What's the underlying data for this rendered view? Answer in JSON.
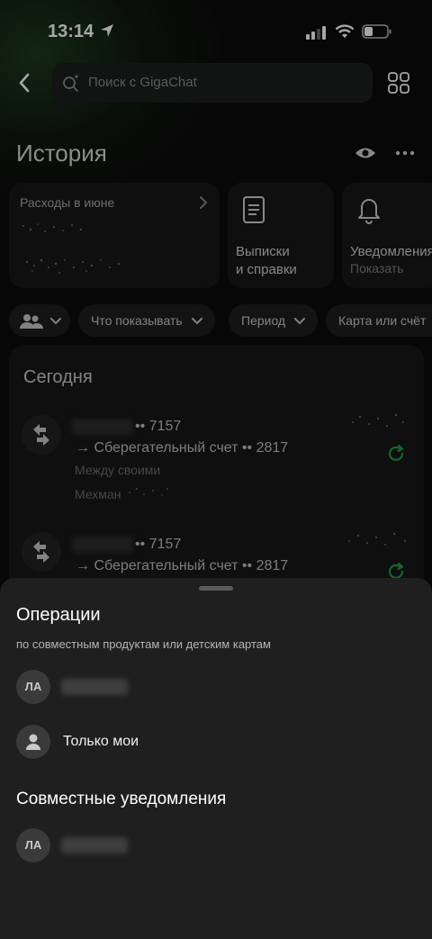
{
  "status_bar": {
    "time": "13:14"
  },
  "search": {
    "placeholder": "Поиск с GigaChat"
  },
  "page": {
    "title": "История"
  },
  "tiles": [
    {
      "label": "Расходы в июне"
    },
    {
      "label": "Выписки\nи справки"
    },
    {
      "label": "Уведомления",
      "sub": "Показать"
    }
  ],
  "filters": {
    "what_to_show": "Что показывать",
    "period": "Период",
    "card_or_account": "Карта или счёт"
  },
  "history": {
    "section": "Сегодня",
    "transactions": [
      {
        "from_suffix": "•• 7157",
        "to": "→  Сберегательный счет •• 2817",
        "category": "Между своими",
        "counterpart": "Мехман"
      },
      {
        "from_suffix": "•• 7157",
        "to": "→  Сберегательный счет •• 2817"
      }
    ]
  },
  "sheet": {
    "title": "Операции",
    "subtitle": "по совместным продуктам или детским картам",
    "options": [
      {
        "avatar": "ЛА"
      },
      {
        "label": "Только мои"
      }
    ],
    "section_title": "Совместные уведомления",
    "notification_options": [
      {
        "avatar": "ЛА"
      }
    ]
  },
  "colors": {
    "accent_green": "#1e9b41",
    "sheet_bg": "#1f1f1f"
  }
}
